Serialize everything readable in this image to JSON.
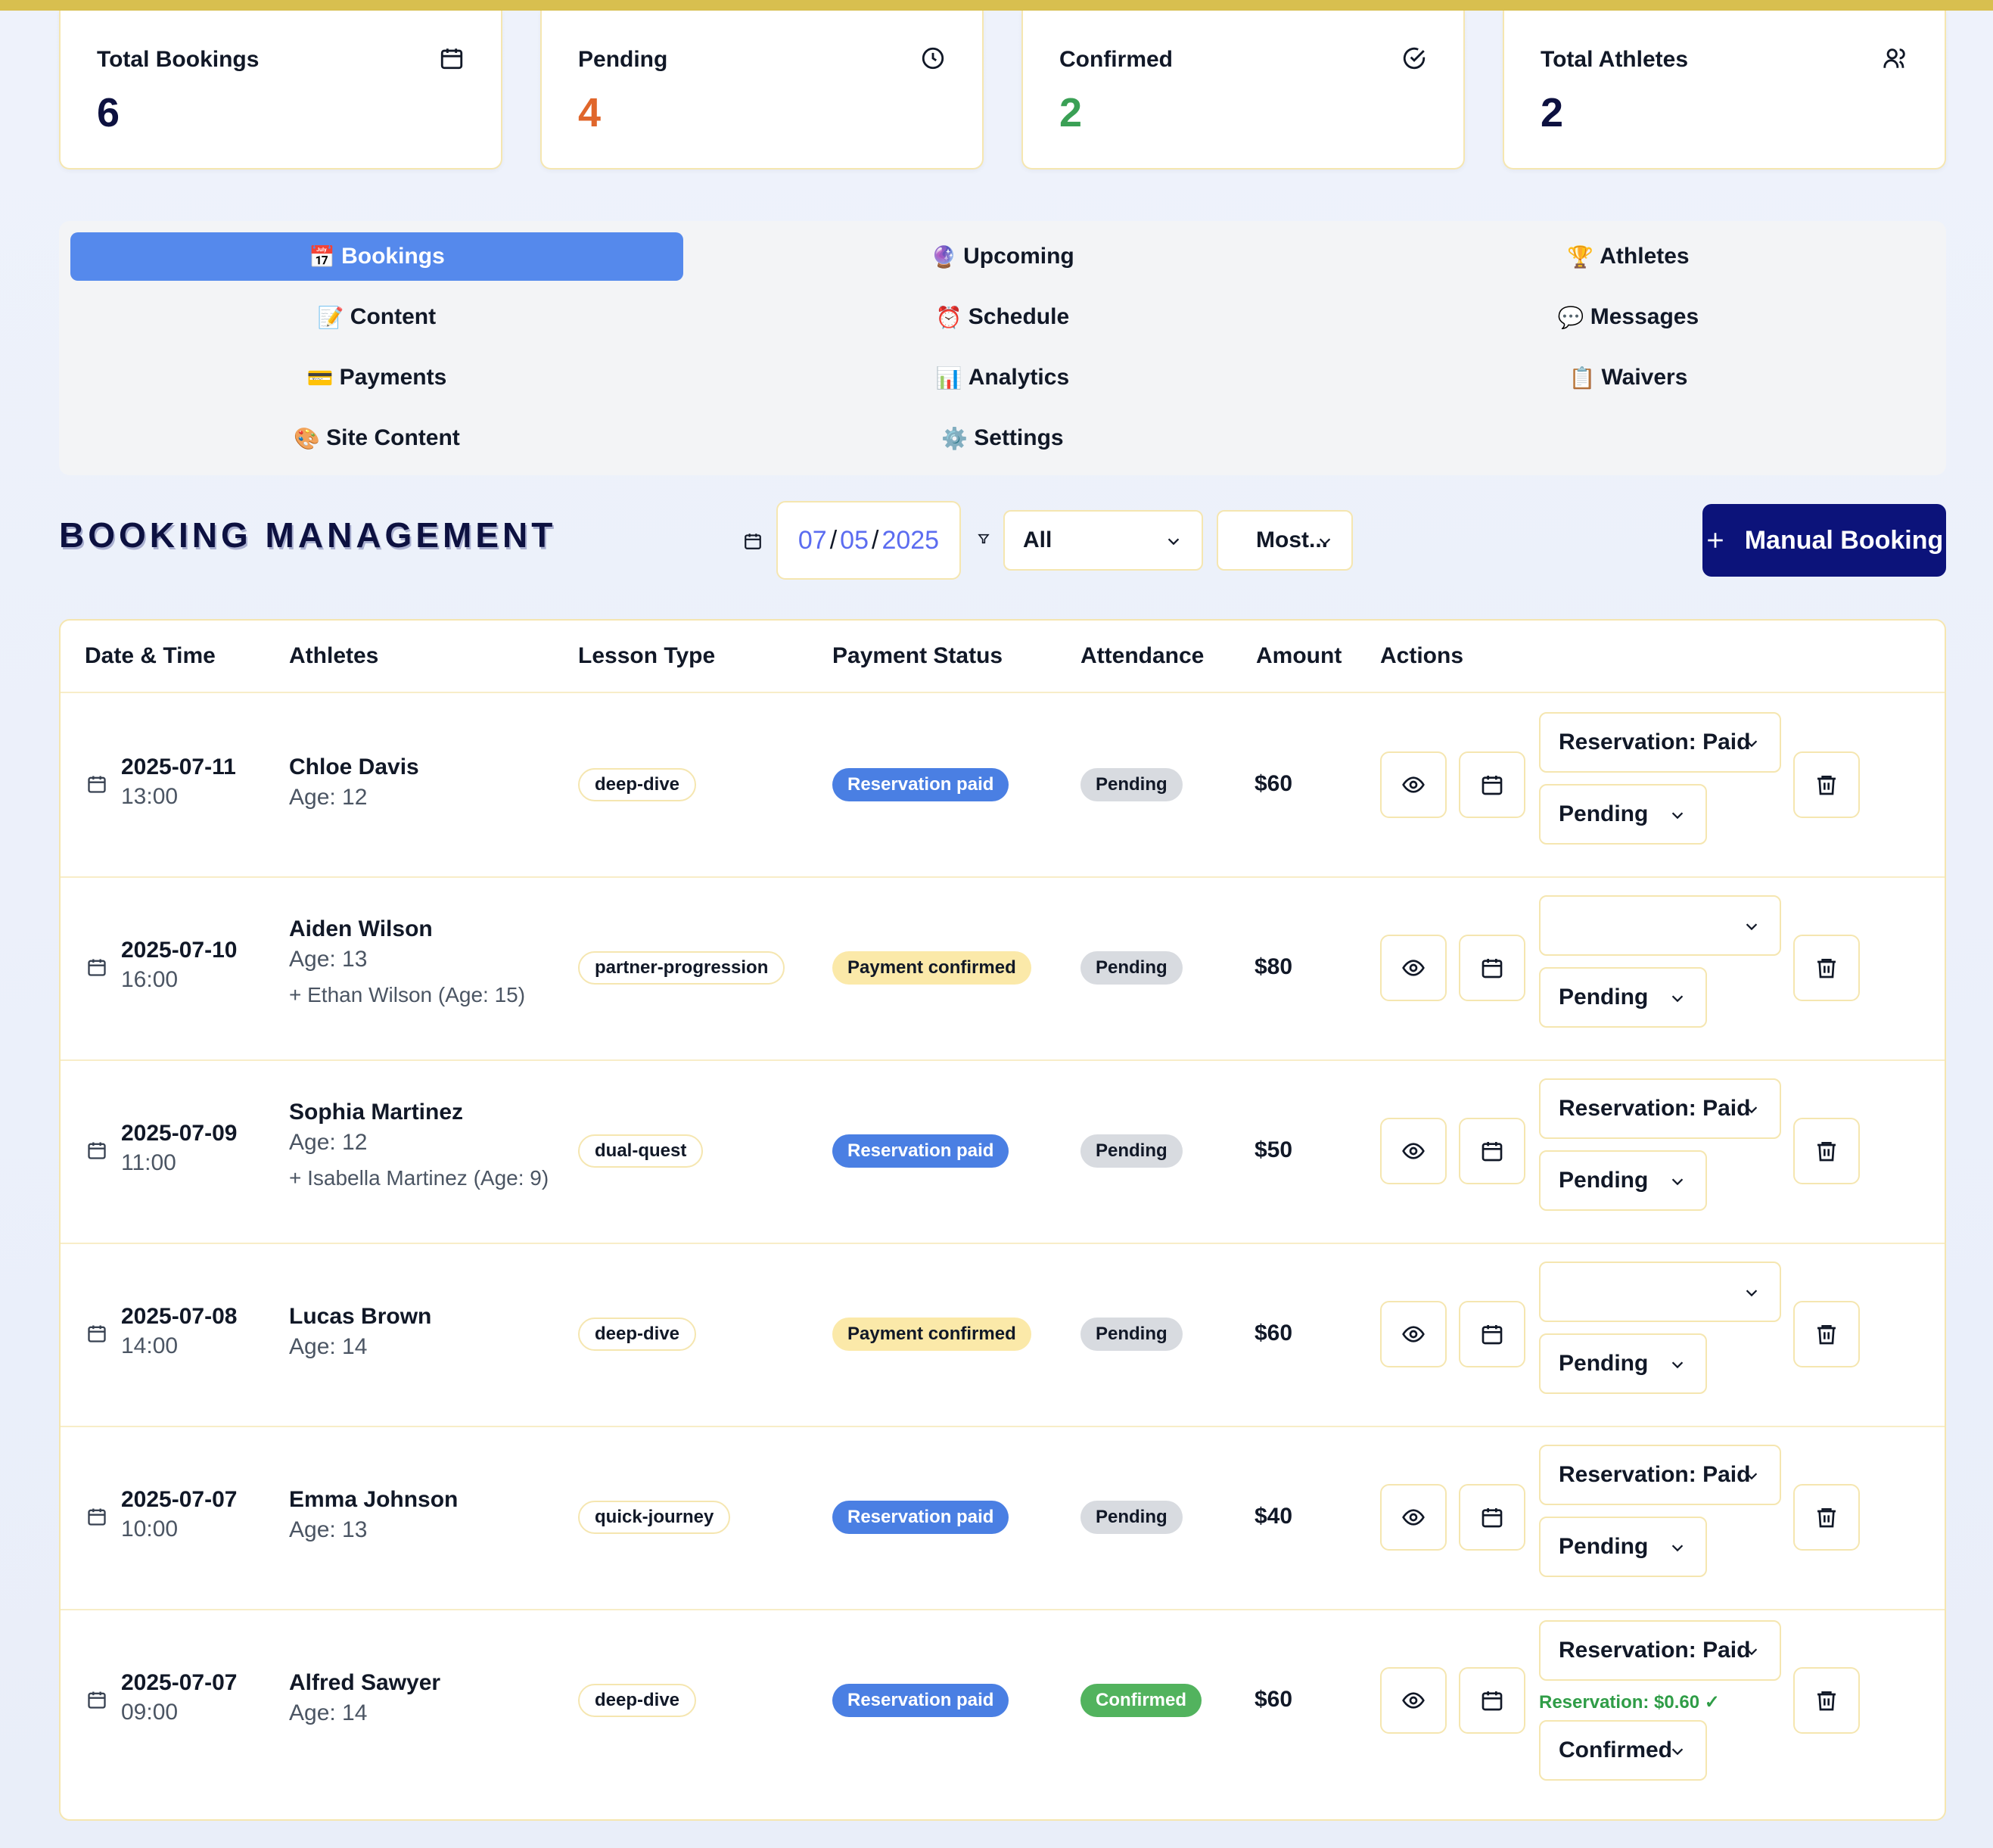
{
  "stats": [
    {
      "label": "Total Bookings",
      "value": "6",
      "icon": "calendar-icon",
      "color": "#0d1140"
    },
    {
      "label": "Pending",
      "value": "4",
      "icon": "clock-icon",
      "color": "#e0662b"
    },
    {
      "label": "Confirmed",
      "value": "2",
      "icon": "check-circle-icon",
      "color": "#3aa055"
    },
    {
      "label": "Total Athletes",
      "value": "2",
      "icon": "users-icon",
      "color": "#0d1140"
    }
  ],
  "tabs": [
    {
      "emoji": "📅",
      "label": "Bookings",
      "active": true
    },
    {
      "emoji": "🔮",
      "label": "Upcoming"
    },
    {
      "emoji": "🏆",
      "label": "Athletes"
    },
    {
      "emoji": "📝",
      "label": "Content"
    },
    {
      "emoji": "⏰",
      "label": "Schedule"
    },
    {
      "emoji": "💬",
      "label": "Messages"
    },
    {
      "emoji": "💳",
      "label": "Payments"
    },
    {
      "emoji": "📊",
      "label": "Analytics"
    },
    {
      "emoji": "📋",
      "label": "Waivers"
    },
    {
      "emoji": "🎨",
      "label": "Site Content"
    },
    {
      "emoji": "⚙️",
      "label": "Settings"
    }
  ],
  "toolbar": {
    "title": "BOOKING MANAGEMENT",
    "date": {
      "month": "07",
      "day": "05",
      "year": "2025"
    },
    "status_filter": "All",
    "sort": "Most...",
    "manual_button": "Manual Booking"
  },
  "table": {
    "headers": [
      "Date & Time",
      "Athletes",
      "Lesson Type",
      "Payment Status",
      "Attendance",
      "Amount",
      "Actions"
    ],
    "rows": [
      {
        "date": "2025-07-11",
        "time": "13:00",
        "athlete": "Chloe Davis",
        "age": "Age: 12",
        "extra": "",
        "lesson": "deep-dive",
        "payment": "Reservation paid",
        "payment_kind": "paid",
        "attendance": "Pending",
        "amount": "$60",
        "res_select": "Reservation: Paid",
        "res_note": "",
        "att_select": "Pending"
      },
      {
        "date": "2025-07-10",
        "time": "16:00",
        "athlete": "Aiden Wilson",
        "age": "Age: 13",
        "extra": "+ Ethan Wilson (Age: 15)",
        "lesson": "partner-progression",
        "payment": "Payment confirmed",
        "payment_kind": "confirmed",
        "attendance": "Pending",
        "amount": "$80",
        "res_select": "",
        "res_note": "",
        "att_select": "Pending"
      },
      {
        "date": "2025-07-09",
        "time": "11:00",
        "athlete": "Sophia Martinez",
        "age": "Age: 12",
        "extra": "+ Isabella Martinez (Age: 9)",
        "lesson": "dual-quest",
        "payment": "Reservation paid",
        "payment_kind": "paid",
        "attendance": "Pending",
        "amount": "$50",
        "res_select": "Reservation: Paid",
        "res_note": "",
        "att_select": "Pending"
      },
      {
        "date": "2025-07-08",
        "time": "14:00",
        "athlete": "Lucas Brown",
        "age": "Age: 14",
        "extra": "",
        "lesson": "deep-dive",
        "payment": "Payment confirmed",
        "payment_kind": "confirmed",
        "attendance": "Pending",
        "amount": "$60",
        "res_select": "",
        "res_note": "",
        "att_select": "Pending"
      },
      {
        "date": "2025-07-07",
        "time": "10:00",
        "athlete": "Emma Johnson",
        "age": "Age: 13",
        "extra": "",
        "lesson": "quick-journey",
        "payment": "Reservation paid",
        "payment_kind": "paid",
        "attendance": "Pending",
        "amount": "$40",
        "res_select": "Reservation: Paid",
        "res_note": "",
        "att_select": "Pending"
      },
      {
        "date": "2025-07-07",
        "time": "09:00",
        "athlete": "Alfred Sawyer",
        "age": "Age: 14",
        "extra": "",
        "lesson": "deep-dive",
        "payment": "Reservation paid",
        "payment_kind": "paid",
        "attendance": "Confirmed",
        "amount": "$60",
        "res_select": "Reservation: Paid",
        "res_note": "Reservation: $0.60 ✓",
        "att_select": "Confirmed"
      }
    ]
  }
}
